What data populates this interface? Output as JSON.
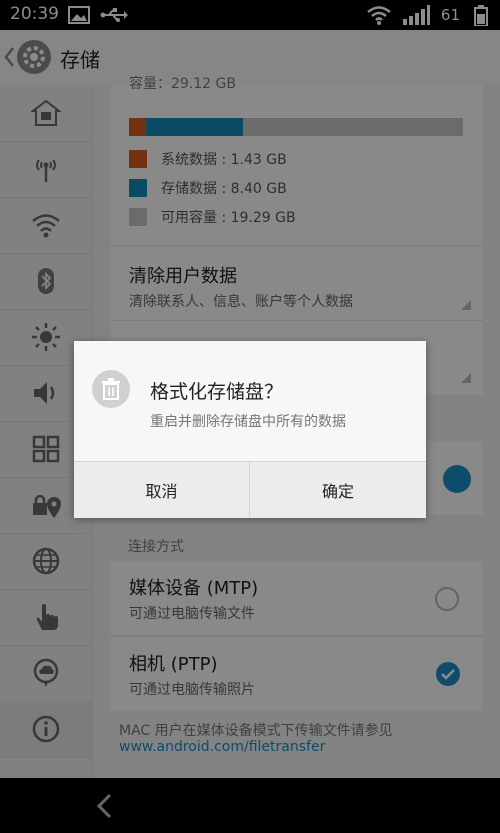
{
  "status_bar": {
    "time": "20:39",
    "battery": "61"
  },
  "action_bar": {
    "title": "存储",
    "back_icon": "chevron-left-icon",
    "app_icon": "gear-icon"
  },
  "sidebar": {
    "items": [
      {
        "name": "home-icon"
      },
      {
        "name": "antenna-icon"
      },
      {
        "name": "wifi-icon"
      },
      {
        "name": "bluetooth-icon"
      },
      {
        "name": "brightness-icon"
      },
      {
        "name": "volume-icon"
      },
      {
        "name": "apps-icon"
      },
      {
        "name": "location-lock-icon"
      },
      {
        "name": "globe-icon"
      },
      {
        "name": "hand-icon"
      },
      {
        "name": "cloud-icon"
      },
      {
        "name": "info-icon"
      }
    ]
  },
  "storage": {
    "capacity_header": "容量：29.12 GB",
    "usage": {
      "system_fraction": 0.05,
      "storage_fraction": 0.29
    },
    "colors": {
      "system": "#d35a1e",
      "storage": "#1288b8",
      "free": "#c4c4c4"
    },
    "legend": [
      {
        "label": "系统数据 : 1.43 GB"
      },
      {
        "label": "存储数据 : 8.40 GB"
      },
      {
        "label": "可用容量 : 19.29 GB"
      }
    ]
  },
  "clear_data": {
    "title": "清除用户数据",
    "subtitle": "清除联系人、信息、账户等个人数据"
  },
  "connection": {
    "header": "连接方式",
    "options": [
      {
        "title": "媒体设备 (MTP)",
        "subtitle": "可通过电脑传输文件",
        "checked": false
      },
      {
        "title": "相机 (PTP)",
        "subtitle": "可通过电脑传输照片",
        "checked": true
      }
    ],
    "footer_text": "MAC 用户在媒体设备模式下传输文件请参见",
    "footer_link": "www.android.com/filetransfer"
  },
  "dialog": {
    "title": "格式化存储盘？",
    "message": "重启并删除存储盘中所有的数据",
    "cancel_label": "取消",
    "ok_label": "确定",
    "icon": "trash-icon"
  },
  "accent_color": "#1d8bc4"
}
